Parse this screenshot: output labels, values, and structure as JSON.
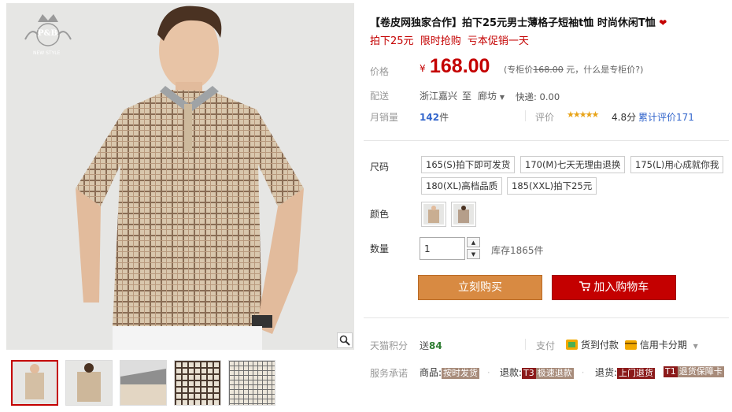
{
  "brand": {
    "logo_text": "P&B",
    "logo_sub": "NEW STYLE"
  },
  "product": {
    "title": "【卷皮网独家合作】拍下25元男士薄格子短袖t恤 时尚休闲T恤",
    "subtitle_parts": [
      "拍下25元",
      "限时抢购",
      "亏本促销一天"
    ]
  },
  "labels": {
    "price": "价格",
    "delivery": "配送",
    "monthly_sales": "月销量",
    "size": "尺码",
    "color": "颜色",
    "quantity": "数量",
    "tmall_points": "天猫积分",
    "service": "服务承诺"
  },
  "price": {
    "currency": "¥",
    "value": "168.00",
    "note_prefix": "(专柜价",
    "original": "168.00",
    "note_suffix": " 元，",
    "note_link": "什么是专柜价?",
    "note_close": ")"
  },
  "delivery": {
    "from": "浙江嘉兴",
    "to_word": "至",
    "to": "廊坊",
    "fee": "快递: 0.00"
  },
  "sales": {
    "count": "142",
    "unit": "件",
    "rating_label": "评价",
    "stars": "★★★★★",
    "score": "4.8分",
    "review_link": "累计评价171"
  },
  "sizes": [
    "165(S)拍下即可发货",
    "170(M)七天无理由退换",
    "175(L)用心成就你我",
    "180(XL)高档品质",
    "185(XXL)拍下25元"
  ],
  "quantity": {
    "value": "1",
    "stock": "库存1865件"
  },
  "buttons": {
    "buy_now": "立刻购买",
    "add_cart": "加入购物车"
  },
  "points": {
    "value_prefix": "送",
    "value": "84"
  },
  "payment": {
    "label": "支付",
    "cod": "货到付款",
    "installment": "信用卡分期"
  },
  "service": {
    "goods": "商品:",
    "goods_tag": "按时发货",
    "refund": "退款:",
    "refund_badge": "T3",
    "refund_tag": "极速退款",
    "return": "退货:",
    "return_tag": "上门退货",
    "t1_badge": "T1",
    "t1_tag": "退货保障卡"
  },
  "colors": {
    "accent": "#c40000",
    "buy": "#d88a42",
    "link": "#3366cc",
    "star": "#e8a317"
  }
}
